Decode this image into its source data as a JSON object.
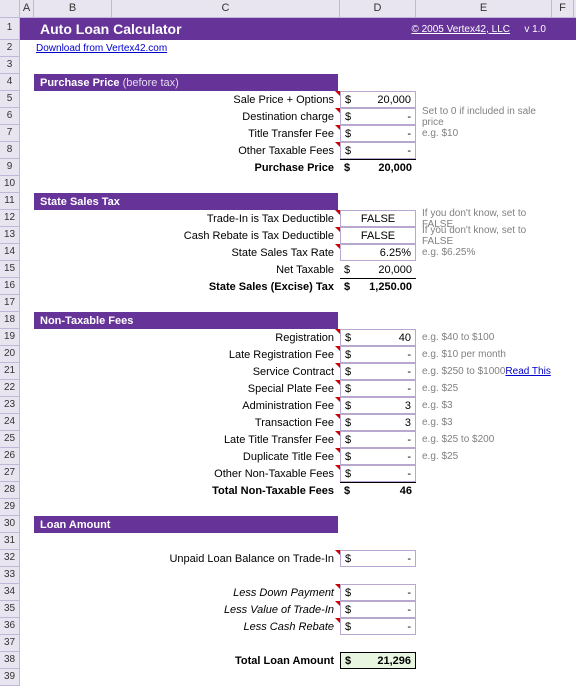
{
  "columns": [
    "A",
    "B",
    "C",
    "D",
    "E",
    "F"
  ],
  "row_numbers": [
    "1",
    "2",
    "3",
    "4",
    "5",
    "6",
    "7",
    "8",
    "9",
    "10",
    "11",
    "12",
    "13",
    "14",
    "15",
    "16",
    "17",
    "18",
    "19",
    "20",
    "21",
    "22",
    "23",
    "24",
    "25",
    "26",
    "27",
    "28",
    "29",
    "30",
    "31",
    "32",
    "33",
    "34",
    "35",
    "36",
    "37",
    "38",
    "39"
  ],
  "title": "Auto Loan Calculator",
  "copyright": "© 2005 Vertex42, LLC",
  "version": "v 1.0",
  "download_link": "Download from Vertex42.com",
  "sections": {
    "purchase": {
      "header": "Purchase Price",
      "header_suffix": "(before tax)",
      "rows": [
        {
          "label": "Sale Price + Options",
          "cur": "$",
          "val": "20,000",
          "note": ""
        },
        {
          "label": "Destination charge",
          "cur": "$",
          "val": "-",
          "note": "Set to 0 if included in sale price"
        },
        {
          "label": "Title Transfer Fee",
          "cur": "$",
          "val": "-",
          "note": "e.g. $10"
        },
        {
          "label": "Other Taxable Fees",
          "cur": "$",
          "val": "-",
          "note": ""
        }
      ],
      "total": {
        "label": "Purchase Price",
        "cur": "$",
        "val": "20,000"
      }
    },
    "tax": {
      "header": "State Sales Tax",
      "rows": [
        {
          "label": "Trade-In is Tax Deductible",
          "val": "FALSE",
          "center": true,
          "note": "If you don't know, set to FALSE"
        },
        {
          "label": "Cash Rebate is Tax Deductible",
          "val": "FALSE",
          "center": true,
          "note": "If you don't know, set to FALSE"
        },
        {
          "label": "State Sales Tax Rate",
          "val": "6.25%",
          "right": true,
          "note": "e.g. $6.25%"
        },
        {
          "label": "Net Taxable",
          "cur": "$",
          "val": "20,000",
          "calc": true,
          "note": ""
        }
      ],
      "total": {
        "label": "State Sales (Excise) Tax",
        "cur": "$",
        "val": "1,250.00"
      }
    },
    "fees": {
      "header": "Non-Taxable Fees",
      "rows": [
        {
          "label": "Registration",
          "cur": "$",
          "val": "40",
          "note": "e.g. $40 to $100"
        },
        {
          "label": "Late Registration Fee",
          "cur": "$",
          "val": "-",
          "note": "e.g. $10 per month"
        },
        {
          "label": "Service Contract",
          "cur": "$",
          "val": "-",
          "note": "e.g. $250 to $1000",
          "link": "Read This"
        },
        {
          "label": "Special Plate Fee",
          "cur": "$",
          "val": "-",
          "note": "e.g. $25"
        },
        {
          "label": "Administration Fee",
          "cur": "$",
          "val": "3",
          "note": "e.g. $3"
        },
        {
          "label": "Transaction Fee",
          "cur": "$",
          "val": "3",
          "note": "e.g. $3"
        },
        {
          "label": "Late Title Transfer Fee",
          "cur": "$",
          "val": "-",
          "note": "e.g. $25 to $200"
        },
        {
          "label": "Duplicate Title Fee",
          "cur": "$",
          "val": "-",
          "note": "e.g. $25"
        },
        {
          "label": "Other Non-Taxable Fees",
          "cur": "$",
          "val": "-",
          "note": ""
        }
      ],
      "total": {
        "label": "Total Non-Taxable Fees",
        "cur": "$",
        "val": "46"
      }
    },
    "loan": {
      "header": "Loan Amount",
      "rows": [
        {
          "label": "Unpaid Loan Balance on Trade-In",
          "cur": "$",
          "val": "-"
        }
      ],
      "less": [
        {
          "label": "Less Down Payment",
          "cur": "$",
          "val": "-"
        },
        {
          "label": "Less Value of Trade-In",
          "cur": "$",
          "val": "-"
        },
        {
          "label": "Less Cash Rebate",
          "cur": "$",
          "val": "-"
        }
      ],
      "total": {
        "label": "Total Loan Amount",
        "cur": "$",
        "val": "21,296"
      }
    }
  }
}
